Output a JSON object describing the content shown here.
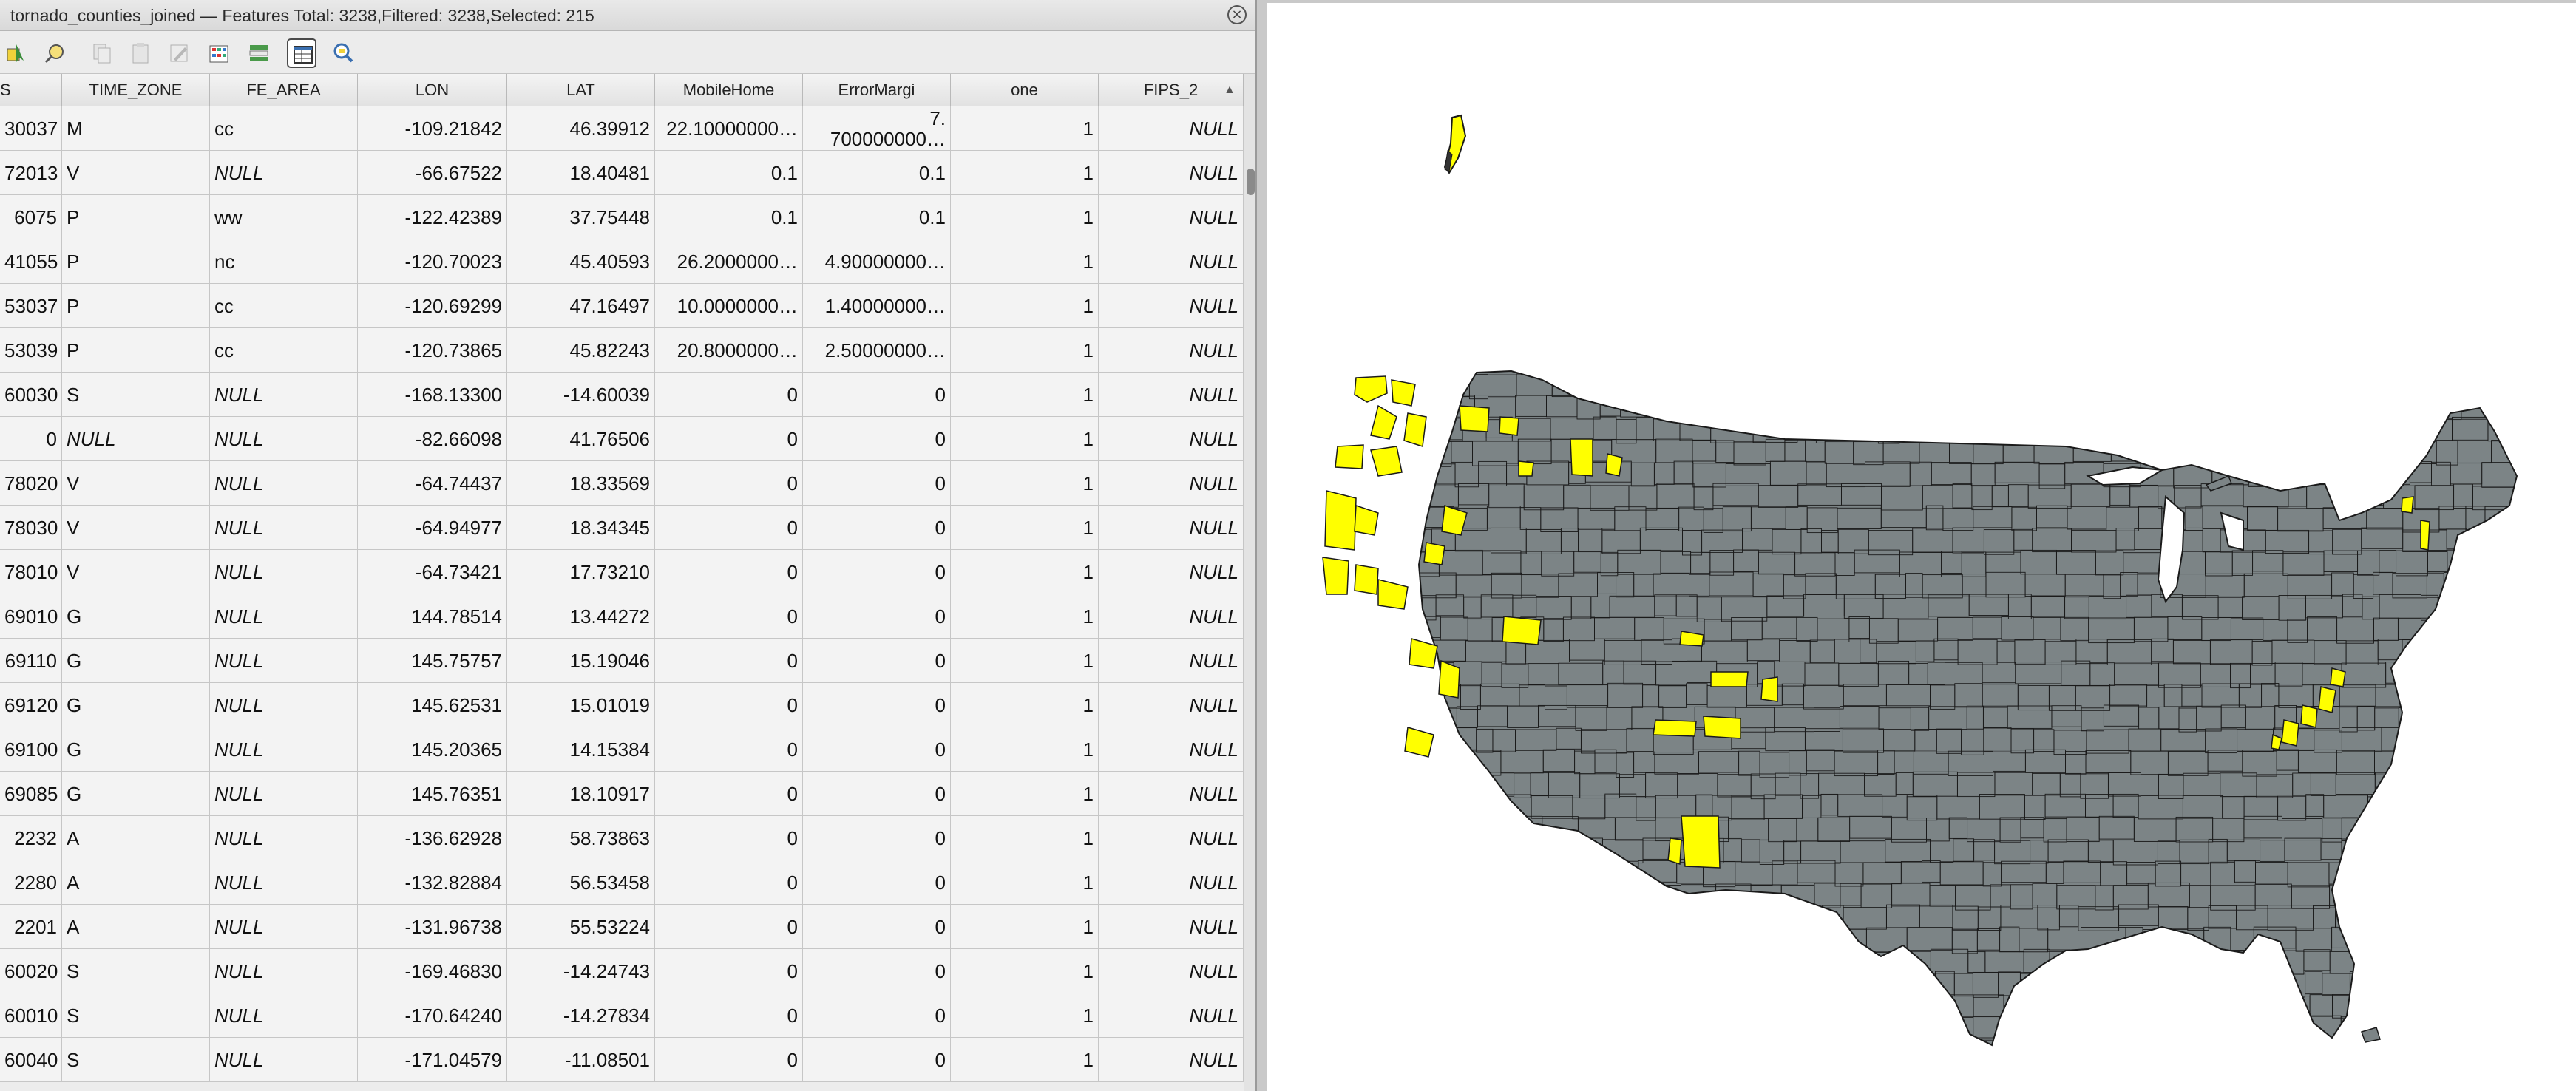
{
  "window": {
    "title": "tornado_counties_joined — Features Total: 3238,Filtered: 3238,Selected: 215",
    "close_glyph": "×"
  },
  "toolbar": {
    "buttons": [
      {
        "name": "select-features-icon",
        "state": "normal"
      },
      {
        "name": "select-by-expression-icon",
        "state": "normal"
      },
      {
        "name": "copy-rows-icon",
        "state": "disabled"
      },
      {
        "name": "paste-rows-icon",
        "state": "disabled"
      },
      {
        "name": "edit-pencil-icon",
        "state": "disabled"
      },
      {
        "name": "field-calculator-icon",
        "state": "normal"
      },
      {
        "name": "conditional-formatting-icon",
        "state": "normal"
      },
      {
        "name": "table-view-icon",
        "state": "active"
      },
      {
        "name": "zoom-to-selection-icon",
        "state": "normal"
      }
    ]
  },
  "table": {
    "columns": [
      "S",
      "TIME_ZONE",
      "FE_AREA",
      "LON",
      "LAT",
      "MobileHome",
      "ErrorMargi",
      "one",
      "FIPS_2"
    ],
    "sort_indicator": "▲",
    "rows": [
      [
        "30037",
        "M",
        "cc",
        "-109.21842",
        "46.39912",
        "22.10000000…",
        "7.|700000000…",
        "1",
        "NULL"
      ],
      [
        "72013",
        "V",
        "NULL",
        "-66.67522",
        "18.40481",
        "0.1",
        "0.1",
        "1",
        "NULL"
      ],
      [
        "6075",
        "P",
        "ww",
        "-122.42389",
        "37.75448",
        "0.1",
        "0.1",
        "1",
        "NULL"
      ],
      [
        "41055",
        "P",
        "nc",
        "-120.70023",
        "45.40593",
        "26.2000000…",
        "4.90000000…",
        "1",
        "NULL"
      ],
      [
        "53037",
        "P",
        "cc",
        "-120.69299",
        "47.16497",
        "10.0000000…",
        "1.40000000…",
        "1",
        "NULL"
      ],
      [
        "53039",
        "P",
        "cc",
        "-120.73865",
        "45.82243",
        "20.8000000…",
        "2.50000000…",
        "1",
        "NULL"
      ],
      [
        "60030",
        "S",
        "NULL",
        "-168.13300",
        "-14.60039",
        "0",
        "0",
        "1",
        "NULL"
      ],
      [
        "0",
        "NULL",
        "NULL",
        "-82.66098",
        "41.76506",
        "0",
        "0",
        "1",
        "NULL"
      ],
      [
        "78020",
        "V",
        "NULL",
        "-64.74437",
        "18.33569",
        "0",
        "0",
        "1",
        "NULL"
      ],
      [
        "78030",
        "V",
        "NULL",
        "-64.94977",
        "18.34345",
        "0",
        "0",
        "1",
        "NULL"
      ],
      [
        "78010",
        "V",
        "NULL",
        "-64.73421",
        "17.73210",
        "0",
        "0",
        "1",
        "NULL"
      ],
      [
        "69010",
        "G",
        "NULL",
        "144.78514",
        "13.44272",
        "0",
        "0",
        "1",
        "NULL"
      ],
      [
        "69110",
        "G",
        "NULL",
        "145.75757",
        "15.19046",
        "0",
        "0",
        "1",
        "NULL"
      ],
      [
        "69120",
        "G",
        "NULL",
        "145.62531",
        "15.01019",
        "0",
        "0",
        "1",
        "NULL"
      ],
      [
        "69100",
        "G",
        "NULL",
        "145.20365",
        "14.15384",
        "0",
        "0",
        "1",
        "NULL"
      ],
      [
        "69085",
        "G",
        "NULL",
        "145.76351",
        "18.10917",
        "0",
        "0",
        "1",
        "NULL"
      ],
      [
        "2232",
        "A",
        "NULL",
        "-136.62928",
        "58.73863",
        "0",
        "0",
        "1",
        "NULL"
      ],
      [
        "2280",
        "A",
        "NULL",
        "-132.82884",
        "56.53458",
        "0",
        "0",
        "1",
        "NULL"
      ],
      [
        "2201",
        "A",
        "NULL",
        "-131.96738",
        "55.53224",
        "0",
        "0",
        "1",
        "NULL"
      ],
      [
        "60020",
        "S",
        "NULL",
        "-169.46830",
        "-14.24743",
        "0",
        "0",
        "1",
        "NULL"
      ],
      [
        "60010",
        "S",
        "NULL",
        "-170.64240",
        "-14.27834",
        "0",
        "0",
        "1",
        "NULL"
      ],
      [
        "60040",
        "S",
        "NULL",
        "-171.04579",
        "-11.08501",
        "0",
        "0",
        "1",
        "NULL"
      ]
    ]
  },
  "map": {
    "fill_color": "#7c8486",
    "selected_color": "#ffff00",
    "stroke_color": "#1a1a1a",
    "background": "#ffffff"
  }
}
